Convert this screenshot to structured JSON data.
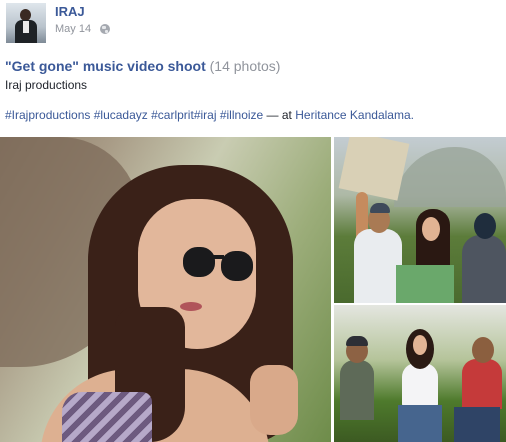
{
  "post": {
    "author": "IRAJ",
    "date": "May 14",
    "privacy_icon": "globe-icon",
    "album": {
      "title": "\"Get gone\" music video shoot",
      "count": "(14 photos)",
      "subtitle": "Iraj productions"
    },
    "tags": [
      "#Irajproductions",
      "#lucadayz",
      "#carlprit",
      "#iraj",
      "#illnoize"
    ],
    "location_prefix": "— at",
    "location": "Heritance Kandalama."
  },
  "photos": [
    {
      "description": "woman-sunglasses-peace-sign"
    },
    {
      "description": "film-crew-on-set"
    },
    {
      "description": "group-seated-outdoors"
    }
  ],
  "colors": {
    "link": "#3b5998",
    "text": "#1d2129",
    "meta": "#90949c"
  }
}
